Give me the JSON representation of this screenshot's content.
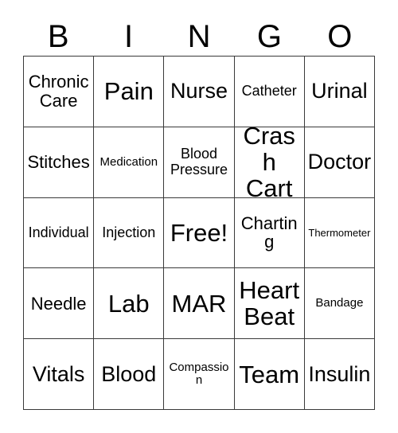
{
  "card": {
    "title_letters": [
      "B",
      "I",
      "N",
      "G",
      "O"
    ],
    "columns": 5,
    "rows": 5,
    "free_space_label": "Free!",
    "border_color": "#3a3a3a",
    "background_color": "#ffffff",
    "text_color": "#000000",
    "cells": [
      [
        {
          "label": "Chronic Care",
          "size": "s-md"
        },
        {
          "label": "Pain",
          "size": "s-xl"
        },
        {
          "label": "Nurse",
          "size": "s-lg"
        },
        {
          "label": "Catheter",
          "size": "s-sm"
        },
        {
          "label": "Urinal",
          "size": "s-lg"
        }
      ],
      [
        {
          "label": "Stitches",
          "size": "s-md"
        },
        {
          "label": "Medication",
          "size": "s-xs"
        },
        {
          "label": "Blood Pressure",
          "size": "s-sm"
        },
        {
          "label": "Crash Cart",
          "size": "s-xl"
        },
        {
          "label": "Doctor",
          "size": "s-lg"
        }
      ],
      [
        {
          "label": "Individual",
          "size": "s-sm"
        },
        {
          "label": "Injection",
          "size": "s-sm"
        },
        {
          "label": "Free!",
          "size": "s-xl"
        },
        {
          "label": "Charting",
          "size": "s-md"
        },
        {
          "label": "Thermometer",
          "size": "s-xxs"
        }
      ],
      [
        {
          "label": "Needle",
          "size": "s-md"
        },
        {
          "label": "Lab",
          "size": "s-xl"
        },
        {
          "label": "MAR",
          "size": "s-xl"
        },
        {
          "label": "Heart Beat",
          "size": "s-xl"
        },
        {
          "label": "Bandage",
          "size": "s-xs"
        }
      ],
      [
        {
          "label": "Vitals",
          "size": "s-lg"
        },
        {
          "label": "Blood",
          "size": "s-lg"
        },
        {
          "label": "Compassion",
          "size": "s-xs"
        },
        {
          "label": "Team",
          "size": "s-xl"
        },
        {
          "label": "Insulin",
          "size": "s-lg"
        }
      ]
    ]
  }
}
